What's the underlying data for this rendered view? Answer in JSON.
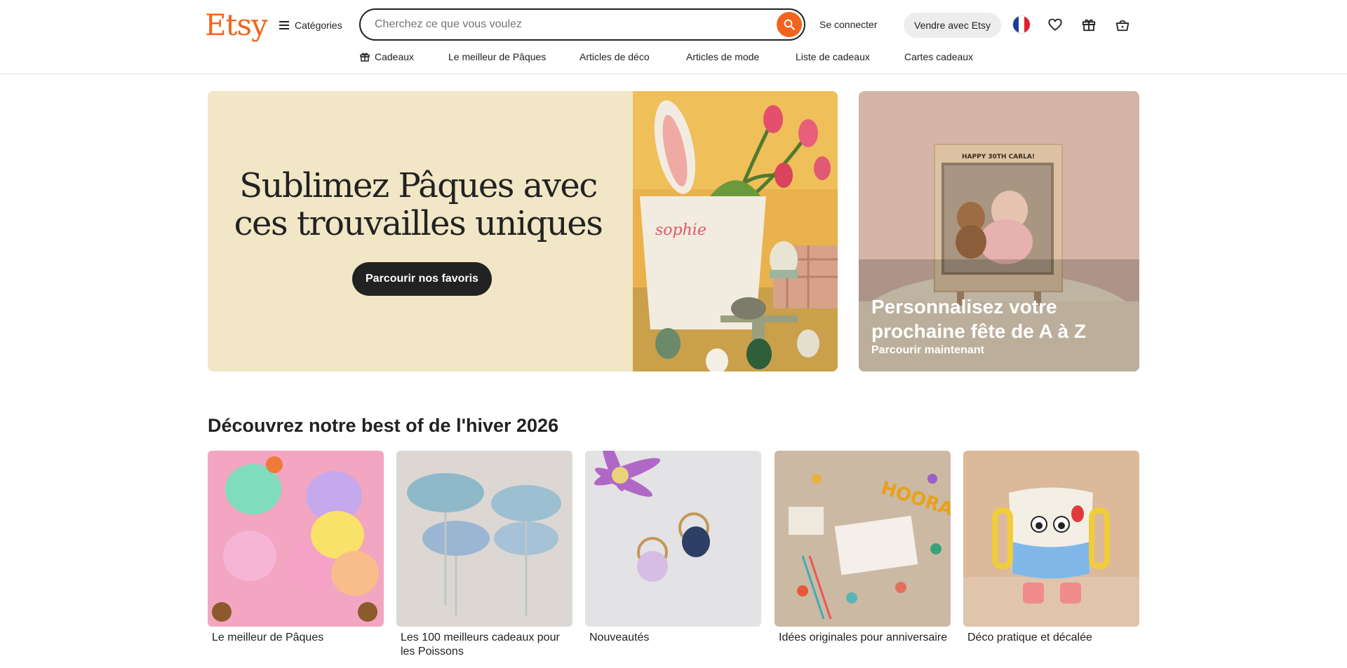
{
  "header": {
    "logo": "Etsy",
    "categories_label": "Catégories",
    "search_placeholder": "Cherchez ce que vous voulez",
    "signin_label": "Se connecter",
    "sell_label": "Vendre avec Etsy",
    "icons": [
      "france-flag-icon",
      "heart-icon",
      "gift-icon",
      "basket-icon"
    ]
  },
  "nav": {
    "items": [
      "Cadeaux",
      "Le meilleur de Pâques",
      "Articles de déco",
      "Articles de mode",
      "Liste de cadeaux",
      "Cartes cadeaux"
    ]
  },
  "hero": {
    "title_line1": "Sublimez Pâques avec",
    "title_line2": "ces trouvailles uniques",
    "button": "Parcourir nos favoris",
    "image_text": "sophie"
  },
  "promo": {
    "title": "Personnalisez votre prochaine fête de A à Z",
    "link": "Parcourir maintenant",
    "image_text": "HAPPY 30TH CARLA!"
  },
  "section": {
    "title": "Découvrez notre best of de l'hiver 2026",
    "cards": [
      {
        "label": "Le meilleur de Pâques"
      },
      {
        "label": "Les 100 meilleurs cadeaux pour les Poissons"
      },
      {
        "label": "Nouveautés"
      },
      {
        "label": "Idées originales pour anniversaire"
      },
      {
        "label": "Déco pratique et décalée"
      }
    ]
  },
  "colors": {
    "brand": "#f1641e",
    "hero_bg": "#f1e6c5",
    "dark": "#222222"
  }
}
